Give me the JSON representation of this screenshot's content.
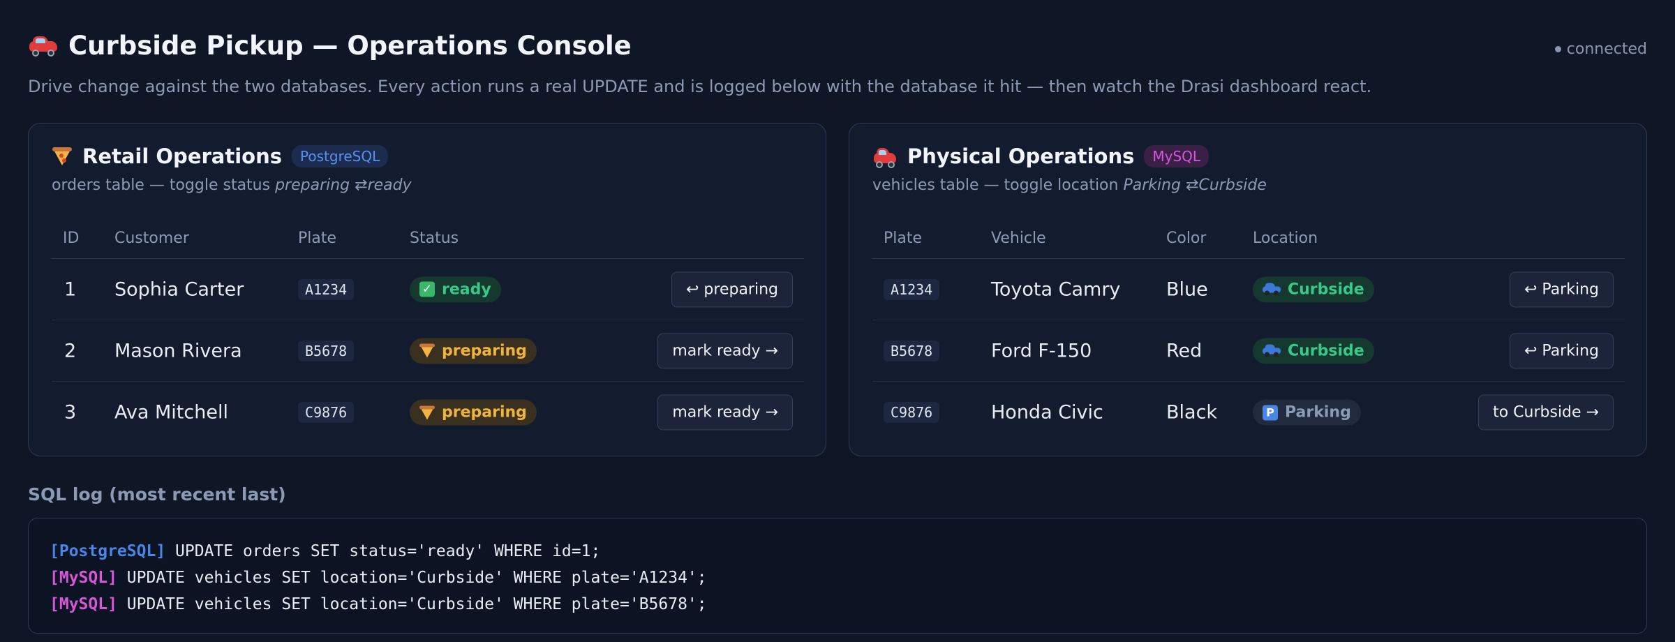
{
  "header": {
    "title": "Curbside Pickup — Operations Console",
    "status": "connected",
    "subtitle": "Drive change against the two databases. Every action runs a real UPDATE and is logged below with the database it hit — then watch the Drasi dashboard react."
  },
  "retail": {
    "title": "Retail Operations",
    "db": "PostgreSQL",
    "desc_prefix": "orders table — toggle status ",
    "desc_a": "preparing",
    "desc_arrow": "⇄",
    "desc_b": "ready",
    "columns": [
      "ID",
      "Customer",
      "Plate",
      "Status"
    ],
    "rows": [
      {
        "id": "1",
        "customer": "Sophia Carter",
        "plate": "A1234",
        "status": "ready",
        "action": "↩ preparing"
      },
      {
        "id": "2",
        "customer": "Mason Rivera",
        "plate": "B5678",
        "status": "preparing",
        "action": "mark ready →"
      },
      {
        "id": "3",
        "customer": "Ava Mitchell",
        "plate": "C9876",
        "status": "preparing",
        "action": "mark ready →"
      }
    ]
  },
  "physical": {
    "title": "Physical Operations",
    "db": "MySQL",
    "desc_prefix": "vehicles table — toggle location ",
    "desc_a": "Parking",
    "desc_arrow": "⇄",
    "desc_b": "Curbside",
    "columns": [
      "Plate",
      "Vehicle",
      "Color",
      "Location"
    ],
    "rows": [
      {
        "plate": "A1234",
        "vehicle": "Toyota Camry",
        "color": "Blue",
        "location": "Curbside",
        "action": "↩ Parking"
      },
      {
        "plate": "B5678",
        "vehicle": "Ford F-150",
        "color": "Red",
        "location": "Curbside",
        "action": "↩ Parking"
      },
      {
        "plate": "C9876",
        "vehicle": "Honda Civic",
        "color": "Black",
        "location": "Parking",
        "action": "to Curbside →"
      }
    ]
  },
  "log": {
    "title": "SQL log (most recent last)",
    "lines": [
      {
        "tag": "[PostgreSQL]",
        "sql": "UPDATE orders SET status='ready' WHERE id=1;"
      },
      {
        "tag": "[MySQL]",
        "sql": "UPDATE vehicles SET location='Curbside' WHERE plate='A1234';"
      },
      {
        "tag": "[MySQL]",
        "sql": "UPDATE vehicles SET location='Curbside' WHERE plate='B5678';"
      }
    ]
  },
  "colors": {
    "background": "#0f1626",
    "postgres": "#4a86e8",
    "mysql": "#d657d8",
    "ready": "#35c98a",
    "preparing": "#f0b43a"
  }
}
